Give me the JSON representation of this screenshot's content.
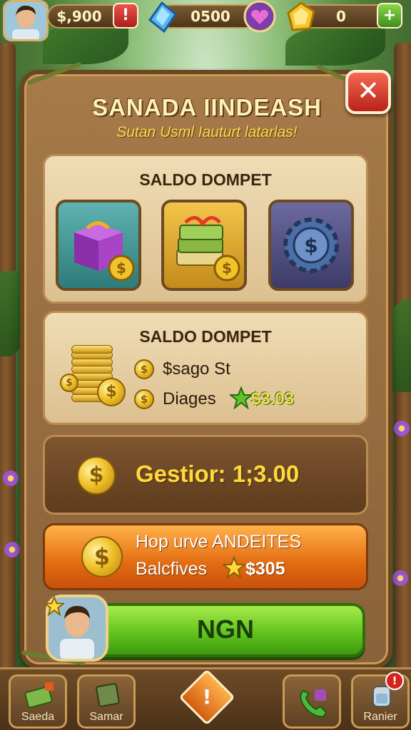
{
  "topbar": {
    "money": "$,900",
    "money_alert": "!",
    "gems": "0500",
    "energy": "0",
    "energy_add": "+"
  },
  "dialog": {
    "title": "SANADA IINDEASH",
    "subtitle": "Sutan Usml Iauturt latarlas!",
    "close_label": "✕"
  },
  "wallet_items": {
    "title": "SALDO DOMPET",
    "items": [
      {
        "name": "purple-gift-box",
        "color": "#5fb3b0"
      },
      {
        "name": "cash-bundle",
        "color": "#f3c54a"
      },
      {
        "name": "coin-gear",
        "color": "#6c6aa0"
      }
    ]
  },
  "wallet_balance": {
    "title": "SALDO DOMPET",
    "row1_label": "$sago St",
    "row2_label": "Diages",
    "row2_value": "$3.03"
  },
  "gestion": {
    "label": "Gestior: 1;3.00"
  },
  "offer": {
    "line1": "Hop urve ANDEITES",
    "line2_label": "Balcfives",
    "line2_value": "$305"
  },
  "action": {
    "button_label": "NGN"
  },
  "nav": {
    "items": [
      {
        "label": "Saeda"
      },
      {
        "label": "Samar"
      },
      {
        "label": "!"
      },
      {
        "label": ""
      },
      {
        "label": "Ranier",
        "badge": "!"
      }
    ]
  },
  "colors": {
    "accent_green": "#5fbf1c",
    "accent_orange": "#e36c12",
    "panel_brown": "#a67a49",
    "close_red": "#d6241c"
  }
}
